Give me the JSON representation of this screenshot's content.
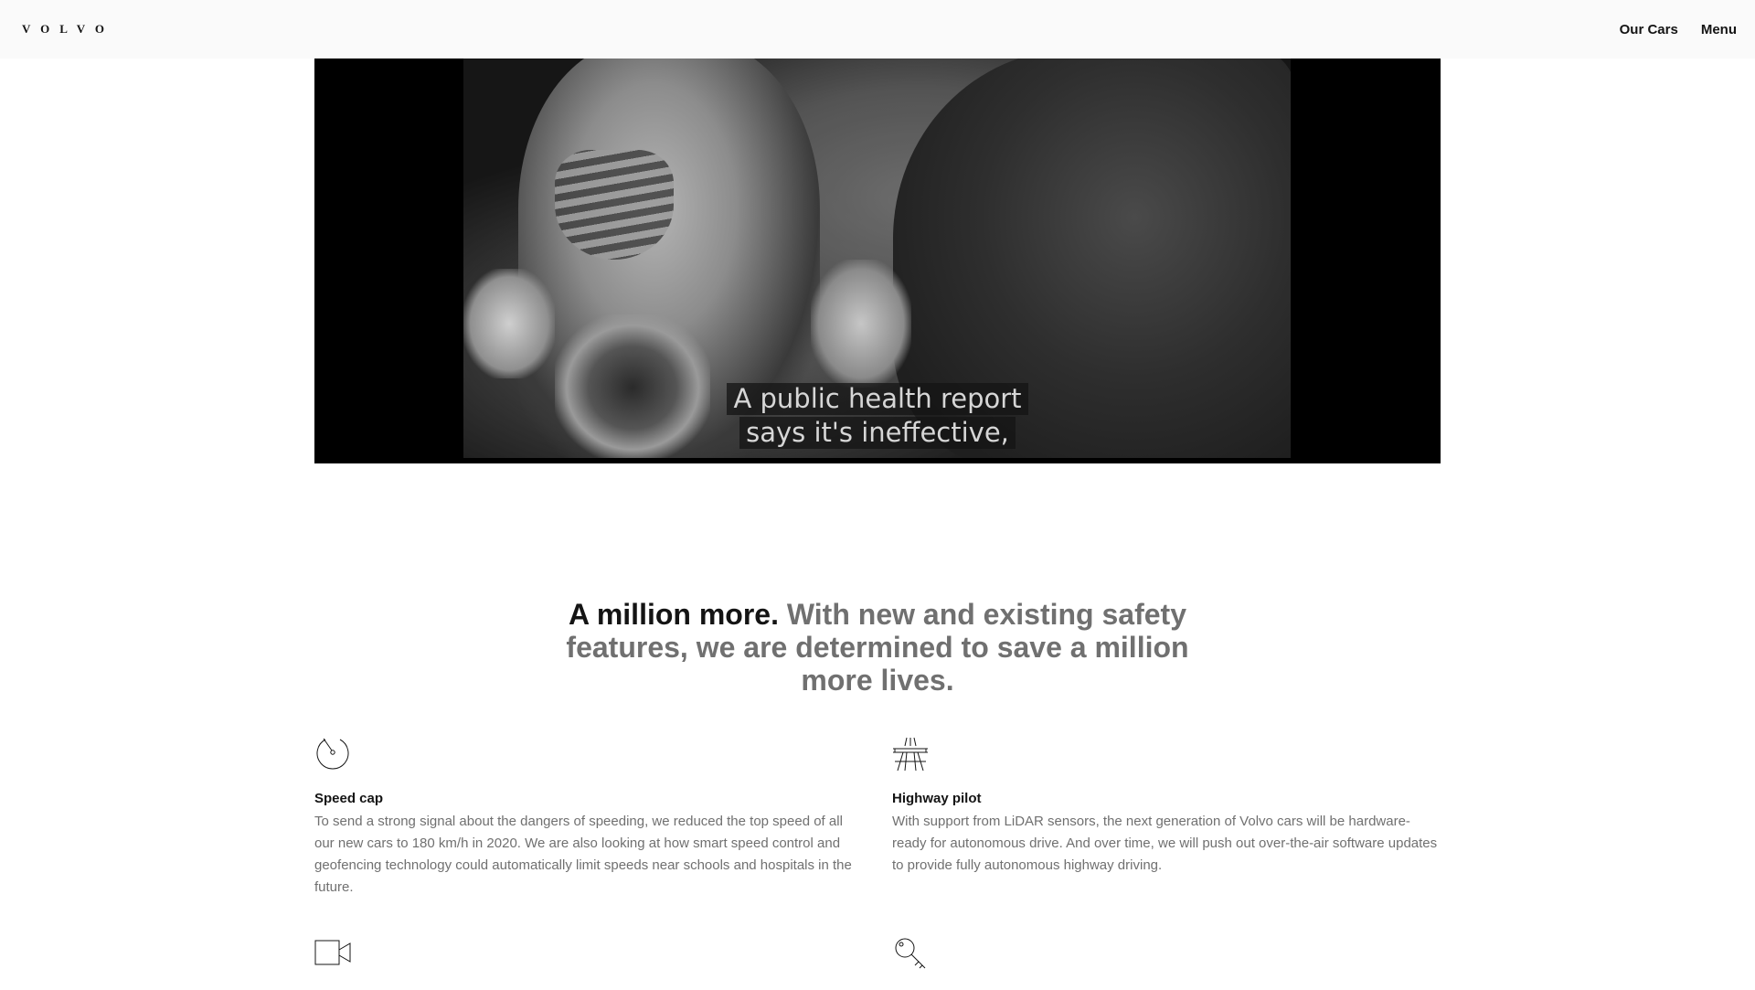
{
  "header": {
    "logo": "VOLVO",
    "nav": [
      "Our Cars",
      "Menu"
    ]
  },
  "video": {
    "subtitle_lines": [
      "A public health report",
      "says it's ineffective,"
    ]
  },
  "statement": {
    "lead": "A million more.",
    "rest": " With new and existing safety features, we are determined to save a million more lives."
  },
  "features": [
    {
      "icon": "speedometer-icon",
      "title": "Speed cap",
      "text": "To send a strong signal about the dangers of speeding, we reduced the top speed of all our new cars to 180 km/h in 2020. We are also looking at how smart speed control and geofencing technology could automatically limit speeds near schools and hospitals in the future."
    },
    {
      "icon": "highway-icon",
      "title": "Highway pilot",
      "text": "With support from LiDAR sensors, the next generation of Volvo cars will be hardware-ready for autonomous drive. And over time, we will push out over-the-air software updates to provide fully autonomous highway driving."
    },
    {
      "icon": "camera-icon",
      "title": "",
      "text": ""
    },
    {
      "icon": "key-icon",
      "title": "",
      "text": ""
    }
  ]
}
